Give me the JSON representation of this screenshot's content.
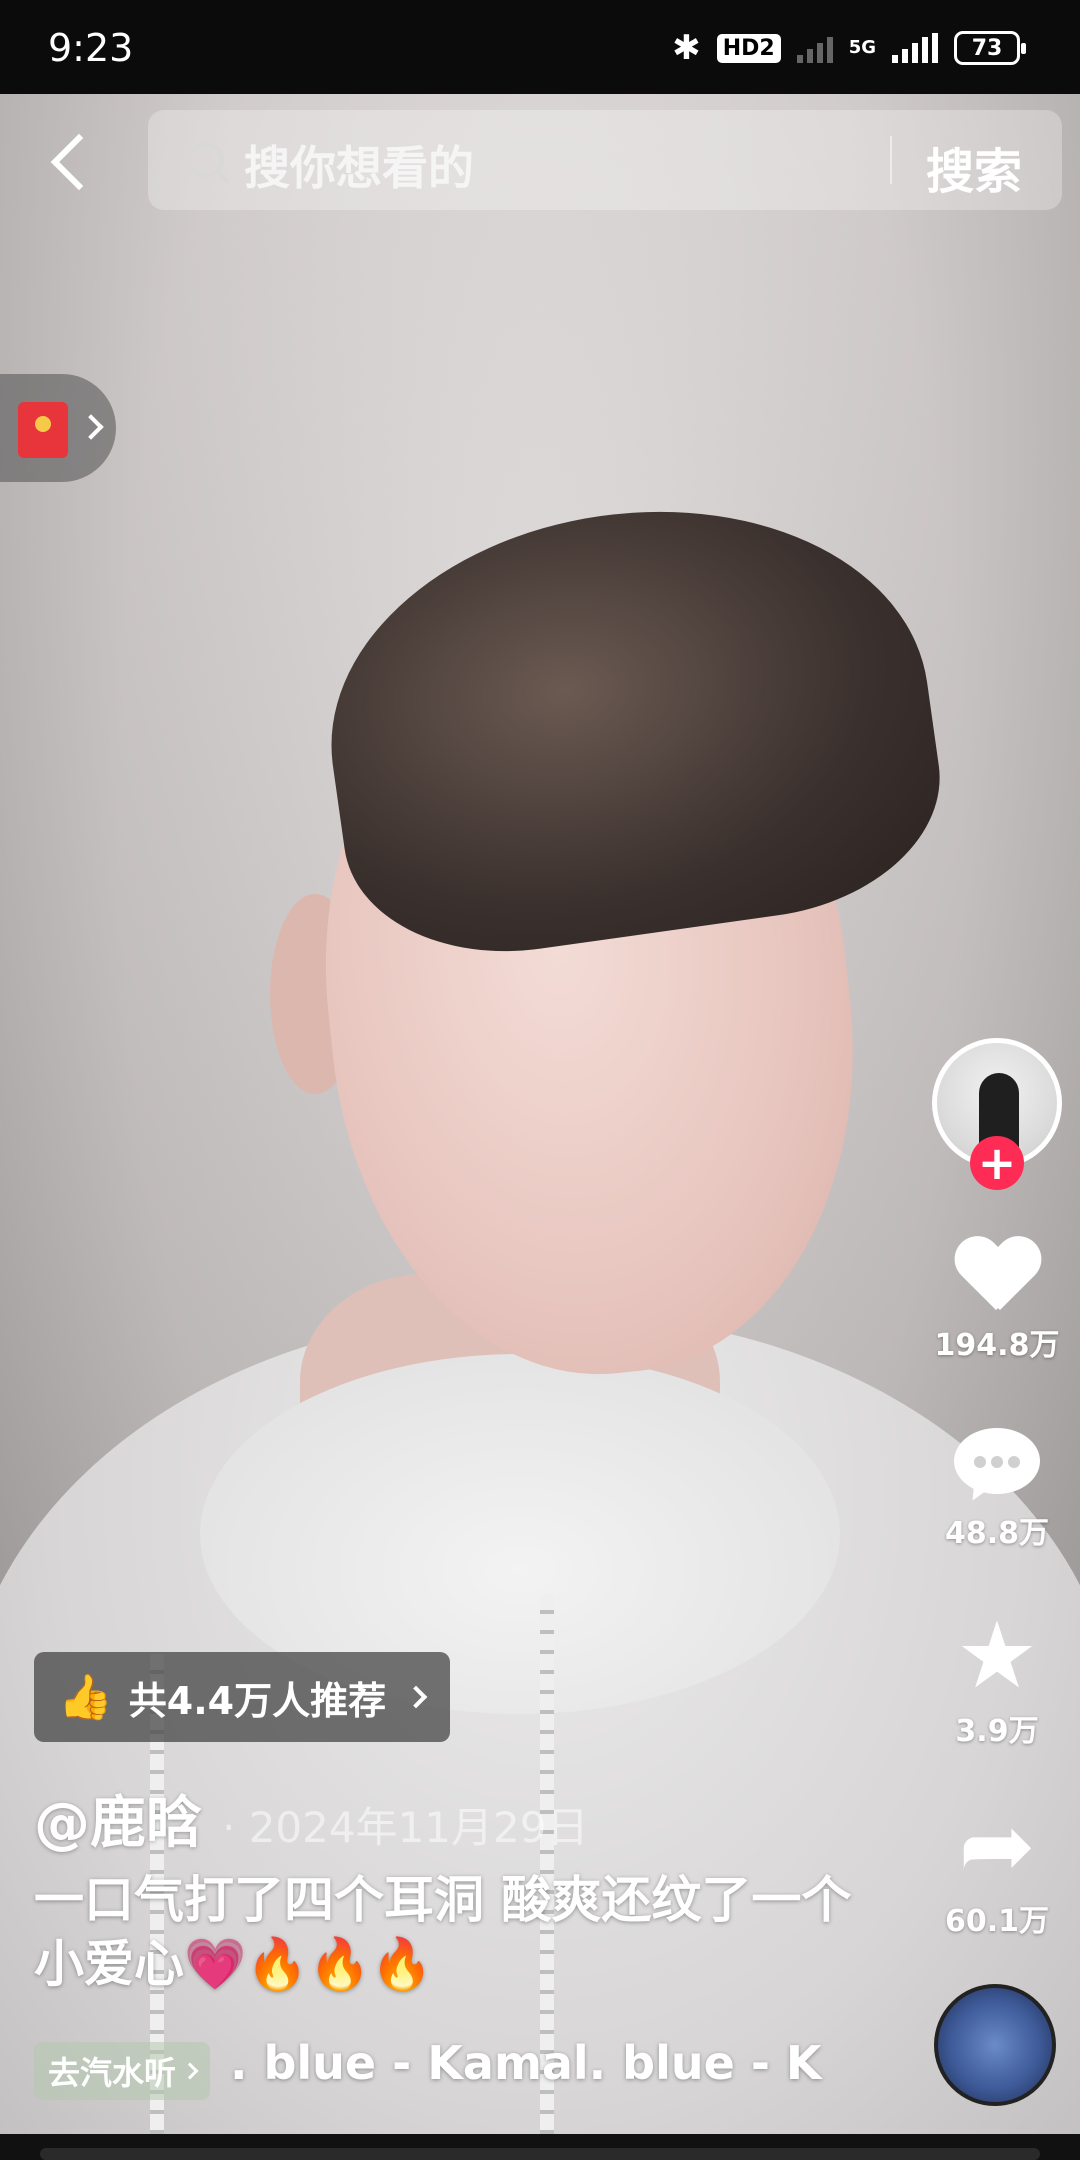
{
  "status_bar": {
    "time": "9:23",
    "hd_label": "HD2",
    "network_label": "5G",
    "battery": "73"
  },
  "search": {
    "placeholder": "搜你想看的",
    "button_label": "搜索"
  },
  "rail": {
    "likes": "194.8万",
    "comments": "48.8万",
    "favorites": "3.9万",
    "shares": "60.1万"
  },
  "post": {
    "recommend_label": "共4.4万人推荐",
    "author": "@鹿晗",
    "date": "· 2024年11月29日",
    "caption": "一口气打了四个耳洞 酸爽还纹了一个小爱心💗🔥🔥🔥"
  },
  "music": {
    "tag_label": "去汽水听",
    "marquee": ".    blue - Kamal.    blue - K"
  },
  "icons": {
    "back": "chevron-left-icon",
    "search": "search-icon",
    "red_packet": "red-packet-icon",
    "follow": "plus-icon",
    "like": "heart-icon",
    "comment": "comment-icon",
    "favorite": "star-icon",
    "share": "share-icon",
    "recommend": "thumbs-up-icon"
  },
  "colors": {
    "accent": "#fe2c55",
    "red_packet": "#e8343b"
  }
}
